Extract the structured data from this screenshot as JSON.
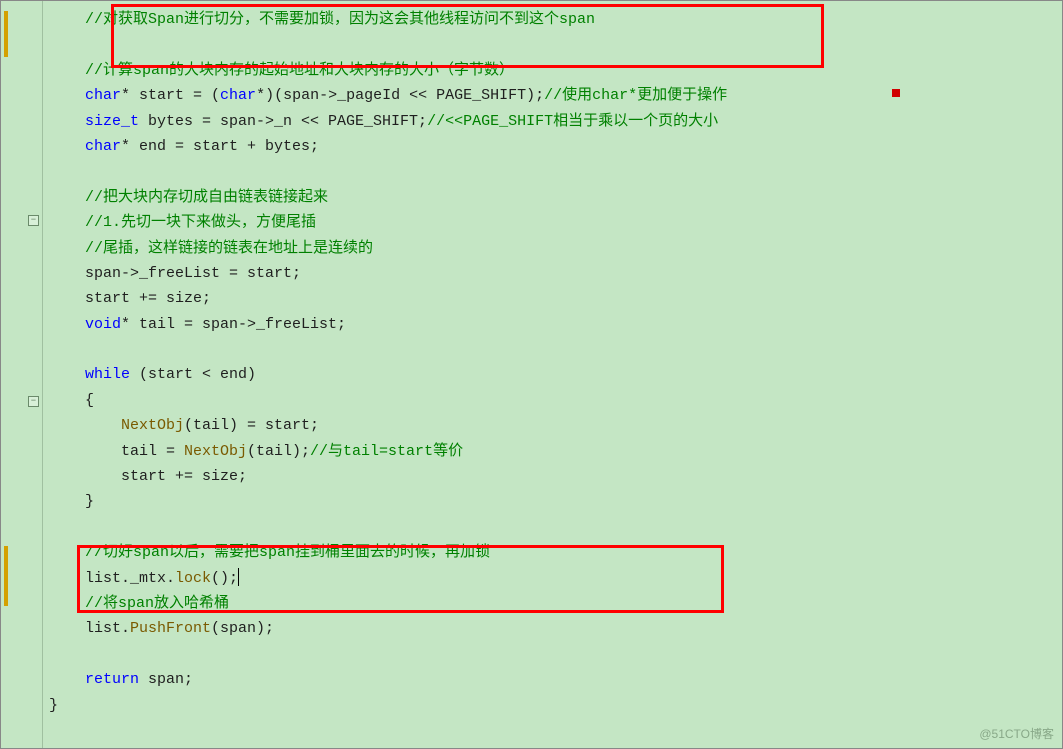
{
  "lines": {
    "l1": "//对获取Span进行切分，不需要加锁，因为这会其他线程访问不到这个span",
    "l2": "",
    "l3": "//计算span的大块内存的起始地址和大块内存的大小（字节数）",
    "l4a": "char",
    "l4b": "* start = (",
    "l4c": "char",
    "l4d": "*)(span->_pageId << PAGE_SHIFT);",
    "l4e": "//使用char*更加便于操作",
    "l5a": "size_t",
    "l5b": " bytes = span->_n << PAGE_SHIFT;",
    "l5c": "//<<PAGE_SHIFT相当于乘以一个页的大小",
    "l6a": "char",
    "l6b": "* end = start + bytes;",
    "l7": "",
    "l8": "//把大块内存切成自由链表链接起来",
    "l9": "//1.先切一块下来做头，方便尾插",
    "l10": "//尾插，这样链接的链表在地址上是连续的",
    "l11": "span->_freeList = start;",
    "l12": "start += size;",
    "l13a": "void",
    "l13b": "* tail = span->_freeList;",
    "l14": "",
    "l15a": "while",
    "l15b": " (start < end)",
    "l16": "{",
    "l17a": "NextObj",
    "l17b": "(tail) = start;",
    "l18a": "tail = ",
    "l18b": "NextObj",
    "l18c": "(tail);",
    "l18d": "//与tail=start等价",
    "l19": "start += size;",
    "l20": "}",
    "l21": "",
    "l22": "//切好span以后，需要把span挂到桶里面去的时候，再加锁",
    "l23a": "list._mtx.",
    "l23b": "lock",
    "l23c": "();",
    "l24": "//将span放入哈希桶",
    "l25a": "list.",
    "l25b": "PushFront",
    "l25c": "(span);",
    "l26": "",
    "l27a": "return",
    "l27b": " span;",
    "l28": "}"
  },
  "fold": "−",
  "watermark": "@51CTO博客"
}
